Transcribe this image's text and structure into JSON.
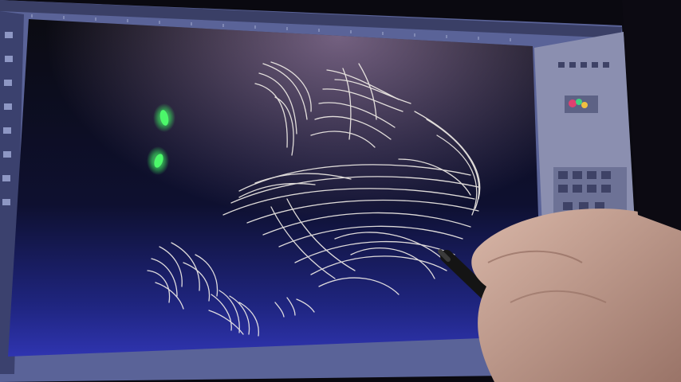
{
  "scene": {
    "kind": "photo-of-drawing-tablet-screen",
    "app_ui": {
      "toolbar": {
        "visible": true
      },
      "layers_panel": {
        "visible": true
      },
      "color_swatch": {
        "visible": true
      }
    },
    "artwork": {
      "subject": "black-cat-painted-with-white-fur-strokes",
      "eye_color": "#3cf060",
      "fur_color": "#f4f0ea",
      "background_gradient": [
        "#0a0a12",
        "#1a1f55",
        "#2d2fa0"
      ]
    },
    "stylus": {
      "color": "#141414"
    },
    "hand": {
      "skin_color": "#c9a596"
    }
  }
}
